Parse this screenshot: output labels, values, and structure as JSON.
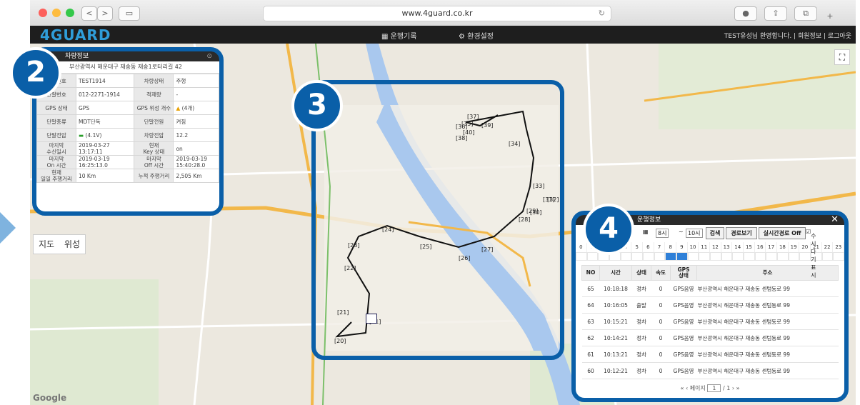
{
  "browser": {
    "url": "www.4guard.co.kr",
    "back": "<",
    "forward": ">",
    "reload_icon": "reload-icon"
  },
  "app": {
    "logo": "4GUARD",
    "menu": [
      "운행기록",
      "환경설정"
    ],
    "user_info": "TEST유성님 환영합니다. | 회원정보 | 로그아웃"
  },
  "map": {
    "tabs": [
      "지도",
      "위성"
    ],
    "provider": "Google",
    "route_labels": [
      "[11]",
      "[20]",
      "[21]",
      "[22]",
      "[23]",
      "[24]",
      "[25]",
      "[26]",
      "[27]",
      "[28]",
      "[29]",
      "[30]",
      "[31]",
      "[32]",
      "[33]",
      "[34]",
      "[35]",
      "[36]",
      "[37]",
      "[38]",
      "[39]",
      "[40]"
    ]
  },
  "callouts": [
    "2",
    "3",
    "4"
  ],
  "vehicle_info": {
    "title": "차량정보",
    "address": "부산광역시 해운대구 재송동 재송1로터리길 42",
    "rows": [
      [
        "차량번호",
        "TEST1914",
        "차량상태",
        "주행"
      ],
      [
        "단말번호",
        "012-2271-1914",
        "적재량",
        "-"
      ],
      [
        "GPS 상태",
        "GPS",
        "GPS 위성 개수",
        "(4개)"
      ],
      [
        "단말종류",
        "MDT단독",
        "단말전원",
        "켜짐"
      ],
      [
        "단말전압",
        "(4.1V)",
        "차량전압",
        "12.2"
      ],
      [
        "마지막\n수신일시",
        "2019-03-27\n13:17:11",
        "현재\nKey 상태",
        "on"
      ],
      [
        "마지막\nOn 시간",
        "2019-03-19\n16:25:13.0",
        "마지막\nOff 시간",
        "2019-03-19\n15:40:28.0"
      ],
      [
        "현재\n일일 주행거리",
        "10 Km",
        "누적 주행거리",
        "2,505 Km"
      ]
    ]
  },
  "history": {
    "title": "운행정보",
    "date_suffix": "12",
    "hour_from": "8시",
    "hour_to": "10시",
    "search_label": "검색",
    "route_label": "경로보기",
    "realtime_label": "실시간경로 Off",
    "realtime_check": "수시다기표시",
    "hours": [
      "0",
      "1",
      "2",
      "3",
      "4",
      "5",
      "6",
      "7",
      "8",
      "9",
      "10",
      "11",
      "12",
      "13",
      "14",
      "15",
      "16",
      "17",
      "18",
      "19",
      "20",
      "21",
      "22",
      "23"
    ],
    "columns": [
      "NO",
      "시간",
      "상태",
      "속도",
      "GPS\n상태",
      "주소"
    ],
    "rows": [
      [
        "65",
        "10:18:18",
        "정차",
        "0",
        "GPS음영",
        "부산광역시 해운대구 재송동 센텀동로 99"
      ],
      [
        "64",
        "10:16:05",
        "출발",
        "0",
        "GPS음영",
        "부산광역시 해운대구 재송동 센텀동로 99"
      ],
      [
        "63",
        "10:15:21",
        "정차",
        "0",
        "GPS음영",
        "부산광역시 해운대구 재송동 센텀동로 99"
      ],
      [
        "62",
        "10:14:21",
        "정차",
        "0",
        "GPS음영",
        "부산광역시 해운대구 재송동 센텀동로 99"
      ],
      [
        "61",
        "10:13:21",
        "정차",
        "0",
        "GPS음영",
        "부산광역시 해운대구 재송동 센텀동로 99"
      ],
      [
        "60",
        "10:12:21",
        "정차",
        "0",
        "GPS음영",
        "부산광역시 해운대구 재송동 센텀동로 99"
      ]
    ],
    "page_label": "페이지",
    "page": "1",
    "page_total": "/ 1"
  },
  "colors": {
    "callout": "#0a5fa8",
    "route": "#111111",
    "river": "#a9c8ee",
    "highway": "#f2b84a",
    "selected_hour": "#2f80d8"
  }
}
